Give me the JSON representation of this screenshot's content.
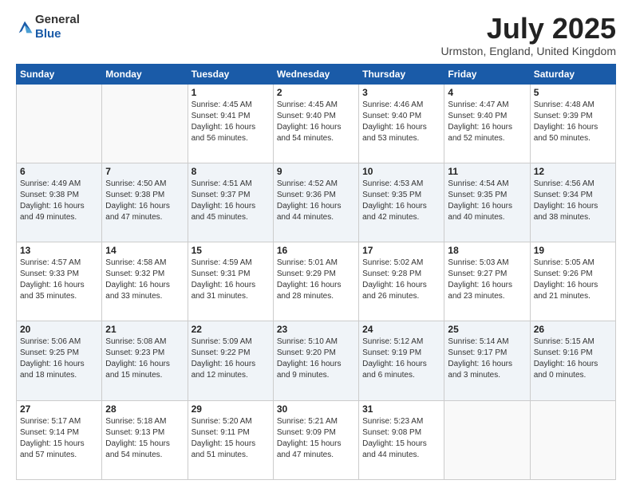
{
  "header": {
    "logo": {
      "general": "General",
      "blue": "Blue"
    },
    "title": "July 2025",
    "location": "Urmston, England, United Kingdom"
  },
  "days_of_week": [
    "Sunday",
    "Monday",
    "Tuesday",
    "Wednesday",
    "Thursday",
    "Friday",
    "Saturday"
  ],
  "weeks": [
    [
      {
        "day": "",
        "sunrise": "",
        "sunset": "",
        "daylight": ""
      },
      {
        "day": "",
        "sunrise": "",
        "sunset": "",
        "daylight": ""
      },
      {
        "day": "1",
        "sunrise": "Sunrise: 4:45 AM",
        "sunset": "Sunset: 9:41 PM",
        "daylight": "Daylight: 16 hours and 56 minutes."
      },
      {
        "day": "2",
        "sunrise": "Sunrise: 4:45 AM",
        "sunset": "Sunset: 9:40 PM",
        "daylight": "Daylight: 16 hours and 54 minutes."
      },
      {
        "day": "3",
        "sunrise": "Sunrise: 4:46 AM",
        "sunset": "Sunset: 9:40 PM",
        "daylight": "Daylight: 16 hours and 53 minutes."
      },
      {
        "day": "4",
        "sunrise": "Sunrise: 4:47 AM",
        "sunset": "Sunset: 9:40 PM",
        "daylight": "Daylight: 16 hours and 52 minutes."
      },
      {
        "day": "5",
        "sunrise": "Sunrise: 4:48 AM",
        "sunset": "Sunset: 9:39 PM",
        "daylight": "Daylight: 16 hours and 50 minutes."
      }
    ],
    [
      {
        "day": "6",
        "sunrise": "Sunrise: 4:49 AM",
        "sunset": "Sunset: 9:38 PM",
        "daylight": "Daylight: 16 hours and 49 minutes."
      },
      {
        "day": "7",
        "sunrise": "Sunrise: 4:50 AM",
        "sunset": "Sunset: 9:38 PM",
        "daylight": "Daylight: 16 hours and 47 minutes."
      },
      {
        "day": "8",
        "sunrise": "Sunrise: 4:51 AM",
        "sunset": "Sunset: 9:37 PM",
        "daylight": "Daylight: 16 hours and 45 minutes."
      },
      {
        "day": "9",
        "sunrise": "Sunrise: 4:52 AM",
        "sunset": "Sunset: 9:36 PM",
        "daylight": "Daylight: 16 hours and 44 minutes."
      },
      {
        "day": "10",
        "sunrise": "Sunrise: 4:53 AM",
        "sunset": "Sunset: 9:35 PM",
        "daylight": "Daylight: 16 hours and 42 minutes."
      },
      {
        "day": "11",
        "sunrise": "Sunrise: 4:54 AM",
        "sunset": "Sunset: 9:35 PM",
        "daylight": "Daylight: 16 hours and 40 minutes."
      },
      {
        "day": "12",
        "sunrise": "Sunrise: 4:56 AM",
        "sunset": "Sunset: 9:34 PM",
        "daylight": "Daylight: 16 hours and 38 minutes."
      }
    ],
    [
      {
        "day": "13",
        "sunrise": "Sunrise: 4:57 AM",
        "sunset": "Sunset: 9:33 PM",
        "daylight": "Daylight: 16 hours and 35 minutes."
      },
      {
        "day": "14",
        "sunrise": "Sunrise: 4:58 AM",
        "sunset": "Sunset: 9:32 PM",
        "daylight": "Daylight: 16 hours and 33 minutes."
      },
      {
        "day": "15",
        "sunrise": "Sunrise: 4:59 AM",
        "sunset": "Sunset: 9:31 PM",
        "daylight": "Daylight: 16 hours and 31 minutes."
      },
      {
        "day": "16",
        "sunrise": "Sunrise: 5:01 AM",
        "sunset": "Sunset: 9:29 PM",
        "daylight": "Daylight: 16 hours and 28 minutes."
      },
      {
        "day": "17",
        "sunrise": "Sunrise: 5:02 AM",
        "sunset": "Sunset: 9:28 PM",
        "daylight": "Daylight: 16 hours and 26 minutes."
      },
      {
        "day": "18",
        "sunrise": "Sunrise: 5:03 AM",
        "sunset": "Sunset: 9:27 PM",
        "daylight": "Daylight: 16 hours and 23 minutes."
      },
      {
        "day": "19",
        "sunrise": "Sunrise: 5:05 AM",
        "sunset": "Sunset: 9:26 PM",
        "daylight": "Daylight: 16 hours and 21 minutes."
      }
    ],
    [
      {
        "day": "20",
        "sunrise": "Sunrise: 5:06 AM",
        "sunset": "Sunset: 9:25 PM",
        "daylight": "Daylight: 16 hours and 18 minutes."
      },
      {
        "day": "21",
        "sunrise": "Sunrise: 5:08 AM",
        "sunset": "Sunset: 9:23 PM",
        "daylight": "Daylight: 16 hours and 15 minutes."
      },
      {
        "day": "22",
        "sunrise": "Sunrise: 5:09 AM",
        "sunset": "Sunset: 9:22 PM",
        "daylight": "Daylight: 16 hours and 12 minutes."
      },
      {
        "day": "23",
        "sunrise": "Sunrise: 5:10 AM",
        "sunset": "Sunset: 9:20 PM",
        "daylight": "Daylight: 16 hours and 9 minutes."
      },
      {
        "day": "24",
        "sunrise": "Sunrise: 5:12 AM",
        "sunset": "Sunset: 9:19 PM",
        "daylight": "Daylight: 16 hours and 6 minutes."
      },
      {
        "day": "25",
        "sunrise": "Sunrise: 5:14 AM",
        "sunset": "Sunset: 9:17 PM",
        "daylight": "Daylight: 16 hours and 3 minutes."
      },
      {
        "day": "26",
        "sunrise": "Sunrise: 5:15 AM",
        "sunset": "Sunset: 9:16 PM",
        "daylight": "Daylight: 16 hours and 0 minutes."
      }
    ],
    [
      {
        "day": "27",
        "sunrise": "Sunrise: 5:17 AM",
        "sunset": "Sunset: 9:14 PM",
        "daylight": "Daylight: 15 hours and 57 minutes."
      },
      {
        "day": "28",
        "sunrise": "Sunrise: 5:18 AM",
        "sunset": "Sunset: 9:13 PM",
        "daylight": "Daylight: 15 hours and 54 minutes."
      },
      {
        "day": "29",
        "sunrise": "Sunrise: 5:20 AM",
        "sunset": "Sunset: 9:11 PM",
        "daylight": "Daylight: 15 hours and 51 minutes."
      },
      {
        "day": "30",
        "sunrise": "Sunrise: 5:21 AM",
        "sunset": "Sunset: 9:09 PM",
        "daylight": "Daylight: 15 hours and 47 minutes."
      },
      {
        "day": "31",
        "sunrise": "Sunrise: 5:23 AM",
        "sunset": "Sunset: 9:08 PM",
        "daylight": "Daylight: 15 hours and 44 minutes."
      },
      {
        "day": "",
        "sunrise": "",
        "sunset": "",
        "daylight": ""
      },
      {
        "day": "",
        "sunrise": "",
        "sunset": "",
        "daylight": ""
      }
    ]
  ]
}
